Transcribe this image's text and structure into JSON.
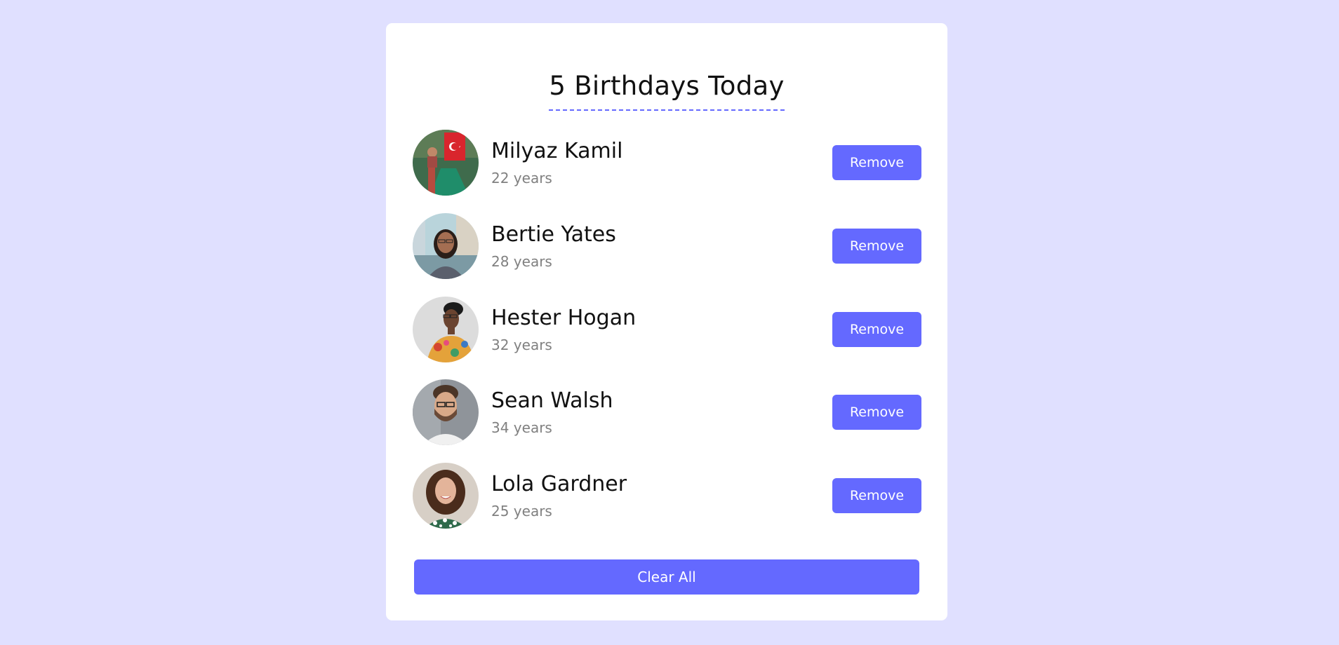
{
  "title": "5 Birthdays Today",
  "people": [
    {
      "name": "Milyaz Kamil",
      "age": "22 years",
      "remove_label": "Remove"
    },
    {
      "name": "Bertie Yates",
      "age": "28 years",
      "remove_label": "Remove"
    },
    {
      "name": "Hester Hogan",
      "age": "32 years",
      "remove_label": "Remove"
    },
    {
      "name": "Sean Walsh",
      "age": "34 years",
      "remove_label": "Remove"
    },
    {
      "name": "Lola Gardner",
      "age": "25 years",
      "remove_label": "Remove"
    }
  ],
  "clear_label": "Clear All",
  "colors": {
    "background": "#e0e0ff",
    "accent": "#6469ff",
    "card": "#ffffff",
    "muted_text": "#808080"
  }
}
